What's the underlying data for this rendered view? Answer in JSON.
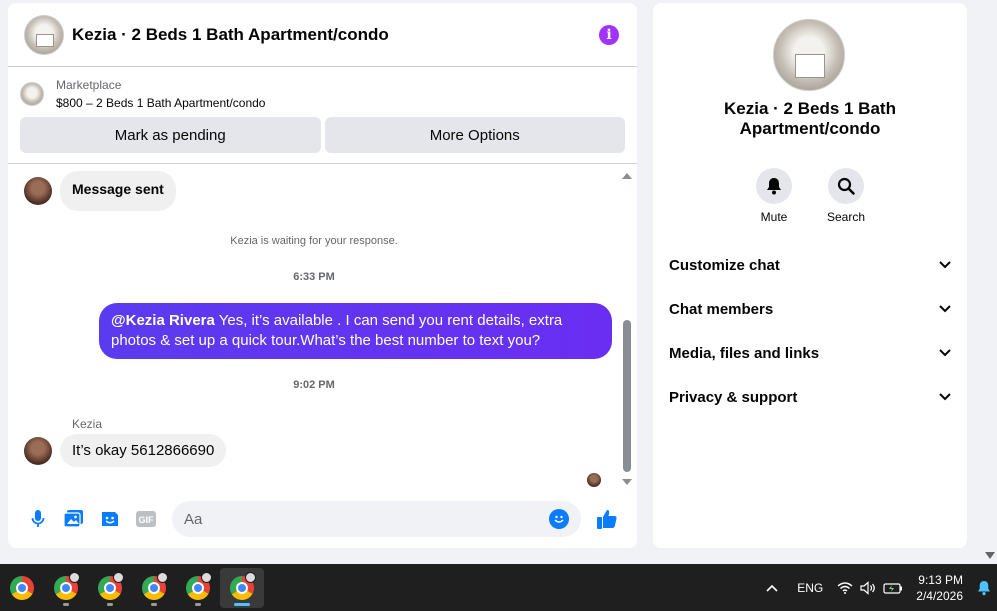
{
  "chat": {
    "title": "Kezia · 2 Beds 1 Bath Apartment/condo",
    "marketplace_label": "Marketplace",
    "listing": "$800 – 2 Beds 1 Bath Apartment/condo",
    "mark_pending_label": "Mark as pending",
    "more_options_label": "More Options",
    "messages": {
      "sent_bubble": "Message sent",
      "waiting_notice": "Kezia is waiting for your response.",
      "time1": "6:33 PM",
      "outgoing_mention": "@Kezia Rivera",
      "outgoing_text": " Yes, it’s available .  I can send you rent details, extra photos & set up a quick tour.What’s the best number to text you?",
      "time2": "9:02 PM",
      "sender_name": "Kezia",
      "incoming_text": "It’s okay 5612866690"
    },
    "composer_placeholder": "Aa"
  },
  "side": {
    "title": "Kezia · 2 Beds 1 Bath Apartment/condo",
    "mute_label": "Mute",
    "search_label": "Search",
    "menu": [
      {
        "label": "Customize chat"
      },
      {
        "label": "Chat members"
      },
      {
        "label": "Media, files and links"
      },
      {
        "label": "Privacy & support"
      }
    ]
  },
  "taskbar": {
    "language": "ENG",
    "time": "9:13 PM",
    "date": "2/4/2026"
  },
  "colors": {
    "accent": "#0a7cff",
    "outgoing_bubble": "#5b3bf0",
    "info_icon": "#a033ff"
  }
}
